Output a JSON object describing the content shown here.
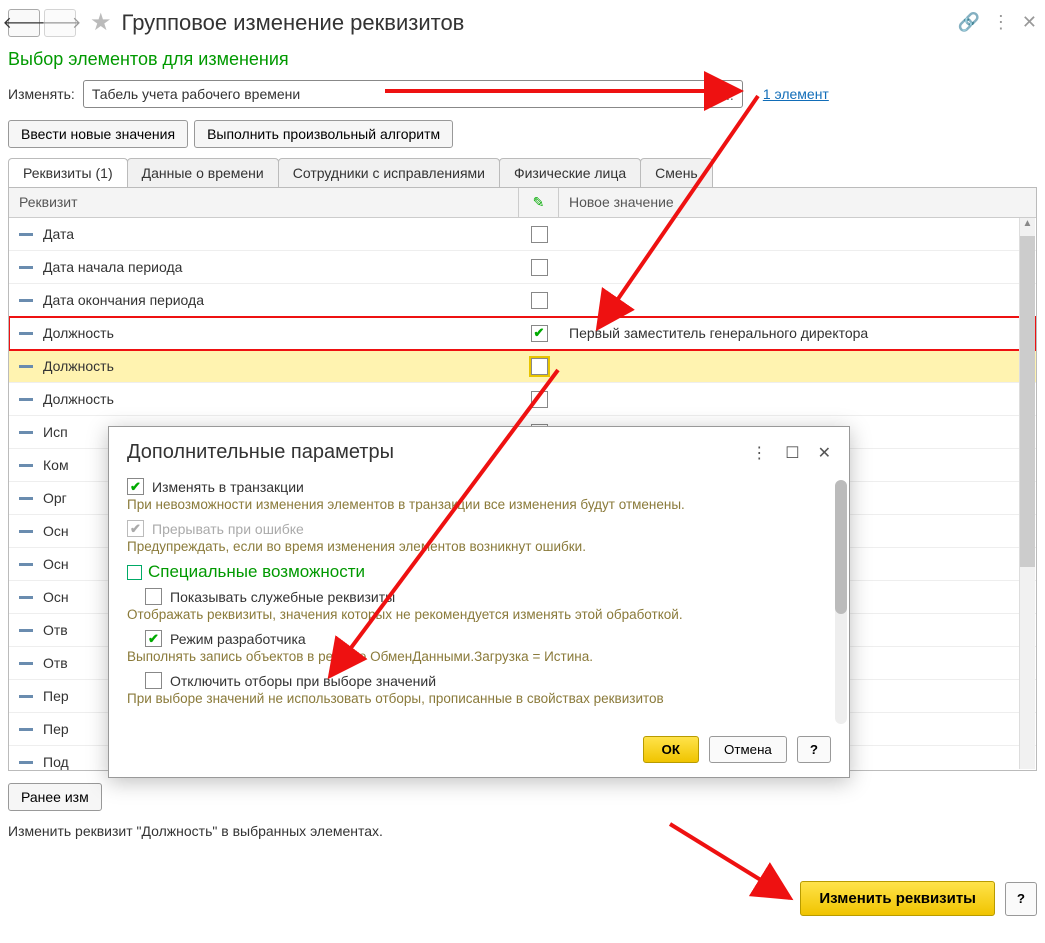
{
  "header": {
    "title": "Групповое изменение реквизитов"
  },
  "section": {
    "title": "Выбор элементов для изменения",
    "change_label": "Изменять:",
    "change_value": "Табель учета рабочего времени",
    "link": "1 элемент"
  },
  "buttons": {
    "enter_values": "Ввести новые значения",
    "run_algorithm": "Выполнить произвольный алгоритм",
    "prev_changed": "Ранее изм",
    "apply": "Изменить реквизиты",
    "help": "?"
  },
  "tabs": [
    "Реквизиты (1)",
    "Данные о времени",
    "Сотрудники с исправлениями",
    "Физические лица",
    "Смень"
  ],
  "grid_headers": {
    "req": "Реквизит",
    "pencil": "✎",
    "value": "Новое значение"
  },
  "rows": [
    {
      "name": "Дата",
      "checked": false,
      "value": ""
    },
    {
      "name": "Дата начала периода",
      "checked": false,
      "value": ""
    },
    {
      "name": "Дата окончания периода",
      "checked": false,
      "value": ""
    },
    {
      "name": "Должность",
      "checked": true,
      "value": "Первый заместитель генерального директора",
      "hl": "red"
    },
    {
      "name": "Должность",
      "checked": false,
      "value": "",
      "hl": "yellow"
    },
    {
      "name": "Должность",
      "checked": false,
      "value": ""
    },
    {
      "name": "Исп",
      "checked": false,
      "value": ""
    },
    {
      "name": "Ком",
      "checked": false,
      "value": ""
    },
    {
      "name": "Орг",
      "checked": false,
      "value": ""
    },
    {
      "name": "Осн",
      "checked": false,
      "value": ""
    },
    {
      "name": "Осн",
      "checked": false,
      "value": ""
    },
    {
      "name": "Осн",
      "checked": false,
      "value": ""
    },
    {
      "name": "Отв",
      "checked": false,
      "value": ""
    },
    {
      "name": "Отв",
      "checked": false,
      "value": ""
    },
    {
      "name": "Пер",
      "checked": false,
      "value": ""
    },
    {
      "name": "Пер",
      "checked": false,
      "value": ""
    },
    {
      "name": "Под",
      "checked": false,
      "value": ""
    }
  ],
  "status": "Изменить реквизит \"Должность\" в выбранных элементах.",
  "dialog": {
    "title": "Дополнительные параметры",
    "tx_label": "Изменять в транзакции",
    "tx_hint": "При невозможности изменения элементов в транзакции все изменения будут отменены.",
    "err_label": "Прерывать при ошибке",
    "err_hint": "Предупреждать, если во время изменения элементов возникнут ошибки.",
    "special": "Специальные возможности",
    "show_service": "Показывать служебные реквизиты",
    "show_service_hint": "Отображать реквизиты, значения которых не рекомендуется изменять этой обработкой.",
    "dev_mode": "Режим разработчика",
    "dev_hint": "Выполнять запись объектов в режиме ОбменДанными.Загрузка = Истина.",
    "disable_filter": "Отключить отборы при выборе значений",
    "disable_filter_hint": "При выборе значений не использовать отборы, прописанные в свойствах реквизитов",
    "ok": "ОК",
    "cancel": "Отмена",
    "help": "?"
  }
}
